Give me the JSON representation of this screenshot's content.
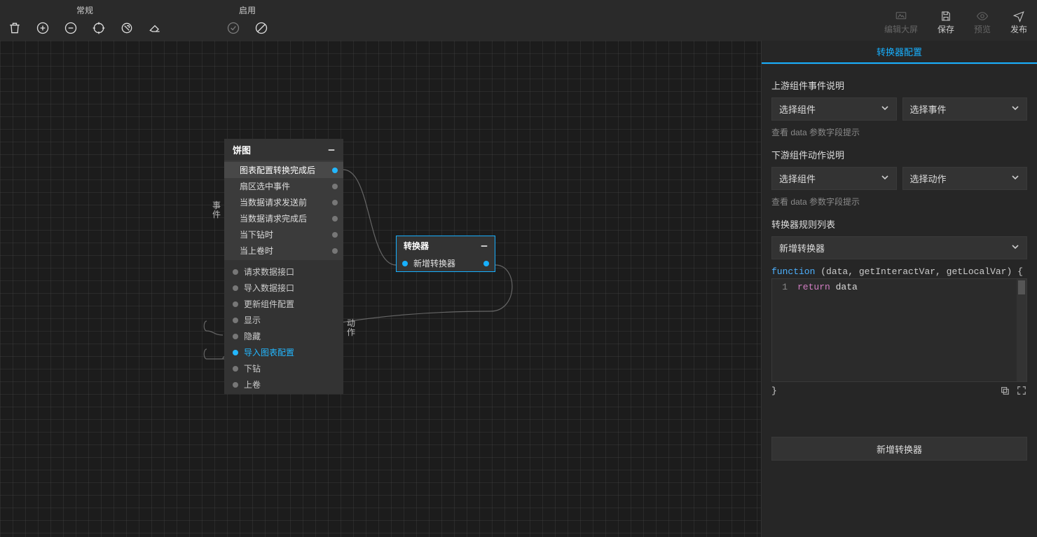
{
  "toolbar": {
    "group_common_label": "常规",
    "group_enable_label": "启用",
    "actions": {
      "edit_screen": "编辑大屏",
      "save": "保存",
      "preview": "预览",
      "publish": "发布"
    }
  },
  "component_node": {
    "title": "饼图",
    "events_label_a": "事",
    "events_label_b": "件",
    "events": [
      {
        "label": "图表配置转换完成后",
        "active": true
      },
      {
        "label": "扇区选中事件",
        "active": false
      },
      {
        "label": "当数据请求发送前",
        "active": false
      },
      {
        "label": "当数据请求完成后",
        "active": false
      },
      {
        "label": "当下钻时",
        "active": false
      },
      {
        "label": "当上卷时",
        "active": false
      }
    ],
    "actions_label_a": "动",
    "actions_label_b": "作",
    "actions": [
      {
        "label": "请求数据接口",
        "active": false
      },
      {
        "label": "导入数据接口",
        "active": false
      },
      {
        "label": "更新组件配置",
        "active": false
      },
      {
        "label": "显示",
        "active": false
      },
      {
        "label": "隐藏",
        "active": false
      },
      {
        "label": "导入图表配置",
        "active": true
      },
      {
        "label": "下钻",
        "active": false
      },
      {
        "label": "上卷",
        "active": false
      }
    ]
  },
  "transformer_node": {
    "title": "转换器",
    "item_label": "新增转换器"
  },
  "panel": {
    "tab_label": "转换器配置",
    "upstream_label": "上游组件事件说明",
    "select_component": "选择组件",
    "select_event": "选择事件",
    "hint_text": "查看 data 参数字段提示",
    "downstream_label": "下游组件动作说明",
    "select_action": "选择动作",
    "rules_label": "转换器规则列表",
    "rule_item_label": "新增转换器",
    "code_sig_kw": "function",
    "code_sig_rest": " (data, getInteractVar, getLocalVar) {",
    "code_line_no": "1",
    "code_kw": "return",
    "code_rest": " data",
    "code_close": "}",
    "add_button_label": "新增转换器"
  }
}
